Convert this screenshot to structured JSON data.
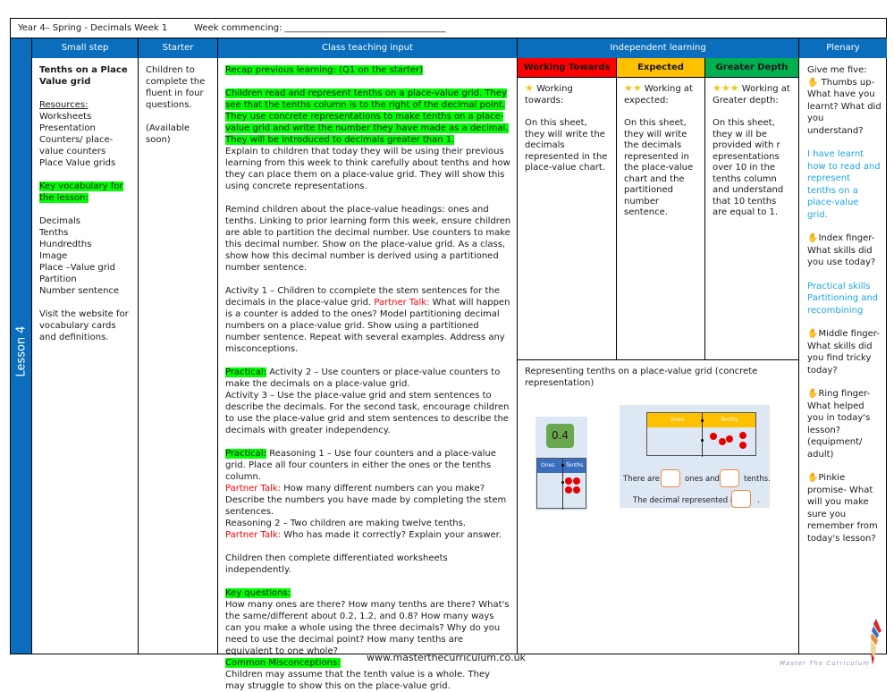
{
  "header": {
    "title": "Year 4– Spring - Decimals Week 1",
    "week_commencing": "Week commencing: ____________________________________"
  },
  "lesson_label": "Lesson 4",
  "columns": {
    "small_step": "Small step",
    "starter": "Starter",
    "class_teaching": "Class teaching input",
    "independent": "Independent learning",
    "plenary": "Plenary"
  },
  "small_step": {
    "title": "Tenths on a Place Value grid",
    "resources_label": "Resources:",
    "resources": [
      "Worksheets",
      "Presentation",
      "Counters/ place-value counters",
      "Place Value grids"
    ],
    "vocab_label": "Key vocabulary for the lesson:",
    "vocab": [
      "Decimals",
      "Tenths",
      "Hundredths",
      "Image",
      "Place –Value grid",
      "Partition",
      "Number sentence"
    ],
    "website_note": "Visit the website for vocabulary cards and definitions."
  },
  "starter": {
    "text": "Children to complete the fluent in four questions.",
    "note": "(Available soon)"
  },
  "teaching": {
    "recap": "Recap previous learning: (Q1 on the starter)",
    "intro": "Children read and represent tenths on a place-value grid. They see that the tenths column is to the right of the decimal point. They use concrete representations to make tenths on a place-value grid and write the number they have made as a decimal. They will be introduced to decimals greater than 1.",
    "explain": "Explain to children that today they will be using their previous learning from this week to think carefully about tenths and how they can place them on a place-value grid. They will show this using concrete representations.",
    "remind": "Remind children about the place-value headings: ones and tenths. Linking to prior learning form this week, ensure children are able to partition the decimal number. Use counters to make this decimal number. Show on the place-value grid. As a class, show how this decimal number is derived using a partitioned number sentence.",
    "activity1_a": "Activity 1 – Children to ccomplete the stem sentences for the decimals in the place-value grid. ",
    "partner_talk": "Partner Talk:",
    "activity1_b": "  What will happen is a counter is added to the ones? Model partitioning decimal numbers on a place-value grid. Show using a partitioned number sentence. Repeat with several examples. Address any misconceptions.",
    "practical": "Practical:",
    "activity2": " Activity 2 – Use counters or place-value counters to make the decimals on a place-value grid.",
    "activity3": "Activity 3 –  Use the place-value grid and stem sentences to describe the decimals. For the second task, encourage children to use the place-value grid and stem sentences to describe the decimals with greater independency.",
    "reasoning1": "  Reasoning 1 – Use four counters and a place-value grid. Place all four counters in either the ones or the tenths column.",
    "pt1": " How many different numbers can you make? Describe the numbers you have made by completing the stem sentences.",
    "reasoning2": "Reasoning 2 – Two children are making twelve tenths.",
    "pt2": " Who has made it correctly? Explain your answer.",
    "worksheets": "Children then complete differentiated worksheets independently.",
    "key_q_label": "Key questions:",
    "key_q": "How many ones are there? How many tenths are there? What's the same/different about 0.2, 1.2, and 0.8? How many ways can you make a whole using the three decimals? Why do you need to use the decimal point? How many tenths are equivalent to one whole?",
    "misc_label": "Common Misconceptions:",
    "misc": "Children may assume that the tenth value is a whole. They may struggle to show this on the place-value grid."
  },
  "independent": {
    "levels": [
      {
        "label": "Working Towards",
        "color": "#ff0000",
        "stars": "★",
        "heading": "Working towards:",
        "text": "On this sheet, they will write the decimals represented in the place-value chart."
      },
      {
        "label": "Expected",
        "color": "#ffc000",
        "stars": "★★",
        "heading": "Working at expected:",
        "text": "On this sheet, they will write the decimals represented in the place-value chart and the partitioned number sentence."
      },
      {
        "label": "Greater Depth",
        "color": "#00b050",
        "stars": "★★★",
        "heading": "Working at Greater depth:",
        "text": "On this sheet, they w ill be provided with r epresentations over 10 in the tenths column and understand that 10 tenths are equal to 1."
      }
    ],
    "rep_title": "Representing tenths on a place-value grid (concrete representation)",
    "pv_a": {
      "value": "0.4",
      "ones": "Ones",
      "tenths": "Tenths"
    },
    "pv_b": {
      "ones": "Ones",
      "tenths": "Tenths",
      "there_are": "There are",
      "ones_and": "ones and",
      "tenths_end": "tenths.",
      "decimal_is": "The decimal represented is",
      "period": "."
    }
  },
  "plenary": {
    "intro": "Give me five:",
    "thumb": "Thumbs up- What have you learnt? What did you understand?",
    "thumb_ans": "I have learnt how to read and represent tenths on a place-value grid.",
    "index": "Index finger- What skills did you use today?",
    "index_ans": "Practical skills Partitioning and recombining",
    "middle": "Middle finger- What skills did you find tricky today?",
    "ring": "Ring finger- What helped you in today's lesson? (equipment/ adult)",
    "pinkie": "Pinkie promise- What will you make sure you remember from today's lesson?"
  },
  "footer": {
    "url": "www.masterthecurriculum.co.uk",
    "logo": "Master The Curriculum"
  }
}
